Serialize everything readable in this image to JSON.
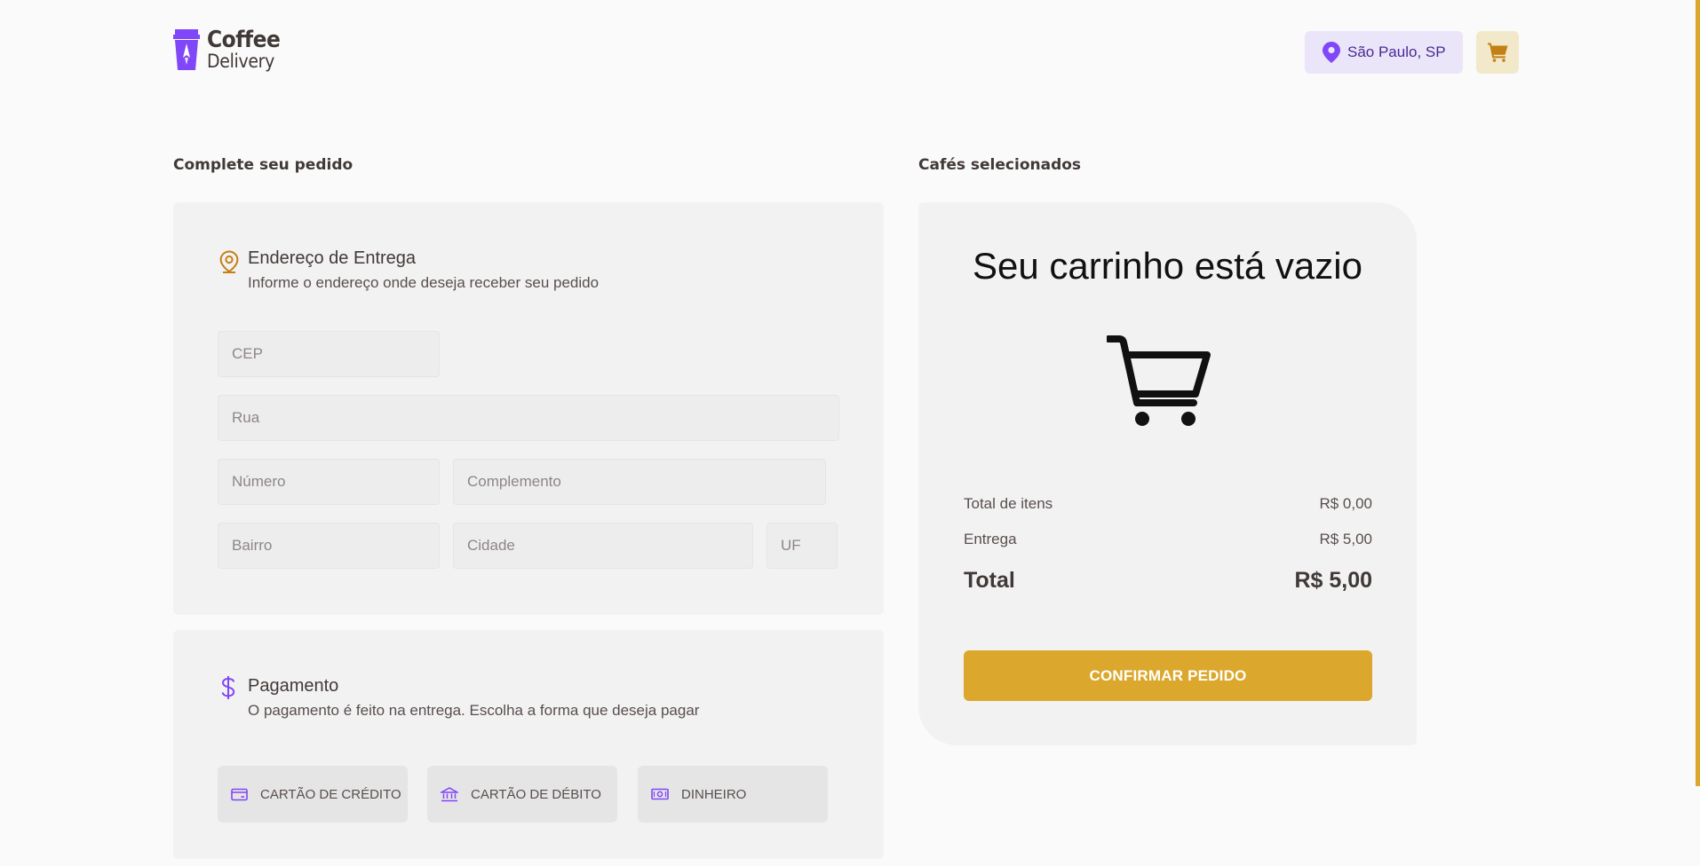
{
  "brand": {
    "name_top": "Coffee",
    "name_bottom": "Delivery"
  },
  "header": {
    "location": "São Paulo, SP"
  },
  "checkout": {
    "title": "Complete seu pedido",
    "address": {
      "title": "Endereço de Entrega",
      "subtitle": "Informe o endereço onde deseja receber seu pedido",
      "fields": {
        "cep": "CEP",
        "rua": "Rua",
        "numero": "Número",
        "complemento": "Complemento",
        "bairro": "Bairro",
        "cidade": "Cidade",
        "uf": "UF"
      }
    },
    "payment": {
      "title": "Pagamento",
      "subtitle": "O pagamento é feito na entrega. Escolha a forma que deseja pagar",
      "options": [
        "CARTÃO DE CRÉDITO",
        "CARTÃO DE DÉBITO",
        "DINHEIRO"
      ]
    }
  },
  "cart": {
    "title": "Cafés selecionados",
    "empty_message": "Seu carrinho está vazio",
    "items_label": "Total de itens",
    "items_value": "R$ 0,00",
    "delivery_label": "Entrega",
    "delivery_value": "R$ 5,00",
    "total_label": "Total",
    "total_value": "R$ 5,00",
    "confirm_label": "CONFIRMAR PEDIDO"
  },
  "colors": {
    "purple": "#8047f8",
    "purple_dark": "#4b2995",
    "yellow": "#dba82d",
    "yellow_dark": "#c47f17"
  }
}
